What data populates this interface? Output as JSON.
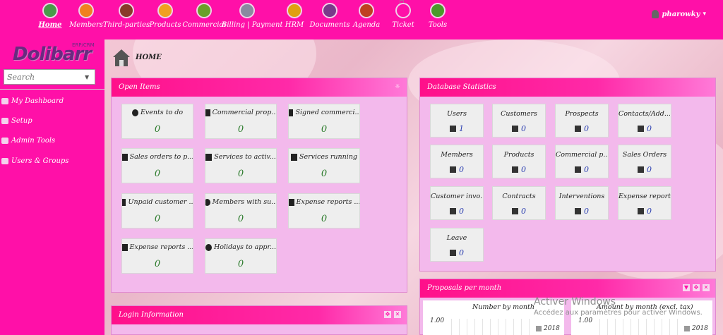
{
  "topnav": {
    "items": [
      {
        "label": "Home",
        "icon": "monitor-icon",
        "color": "#4a9a4a"
      },
      {
        "label": "Members",
        "icon": "members-icon",
        "color": "#f08020"
      },
      {
        "label": "Third-parties",
        "icon": "third-parties-icon",
        "color": "#8a3a2a"
      },
      {
        "label": "Products",
        "icon": "products-icon",
        "color": "#f0a020"
      },
      {
        "label": "Commercial",
        "icon": "commercial-icon",
        "color": "#6aa02a"
      },
      {
        "label": "Billing | Payment",
        "icon": "billing-icon",
        "color": "#8a8aa0"
      },
      {
        "label": "HRM",
        "icon": "hrm-icon",
        "color": "#e0a010"
      },
      {
        "label": "Documents",
        "icon": "documents-icon",
        "color": "#7a3a8a"
      },
      {
        "label": "Agenda",
        "icon": "agenda-icon",
        "color": "#c04020"
      },
      {
        "label": "Ticket",
        "icon": "ticket-icon",
        "color": "#ff10a8"
      },
      {
        "label": "Tools",
        "icon": "tools-icon",
        "color": "#4a9a2a"
      }
    ],
    "user": "pharowky"
  },
  "sidebar": {
    "logo": "Dolibarr",
    "logo_sub": "ERP/CRM",
    "search_placeholder": "Search",
    "items": [
      {
        "label": "My Dashboard",
        "icon": "dashboard-icon"
      },
      {
        "label": "Setup",
        "icon": "wrench-icon"
      },
      {
        "label": "Admin Tools",
        "icon": "admin-tools-icon"
      },
      {
        "label": "Users & Groups",
        "icon": "users-groups-icon"
      }
    ]
  },
  "page": {
    "title": "HOME"
  },
  "open_items": {
    "title": "Open Items",
    "boxes": [
      {
        "label": "Events to do",
        "value": "0",
        "icon": "clock-icon"
      },
      {
        "label": "Commercial prop...",
        "value": "0",
        "icon": "proposal-icon"
      },
      {
        "label": "Signed commerci...",
        "value": "0",
        "icon": "proposal-icon"
      },
      {
        "label": "Sales orders to p...",
        "value": "0",
        "icon": "order-icon"
      },
      {
        "label": "Services to activ...",
        "value": "0",
        "icon": "service-icon"
      },
      {
        "label": "Services running",
        "value": "0",
        "icon": "service-icon"
      },
      {
        "label": "Unpaid customer ...",
        "value": "0",
        "icon": "invoice-icon"
      },
      {
        "label": "Members with su...",
        "value": "0",
        "icon": "member-icon"
      },
      {
        "label": "Expense reports ...",
        "value": "0",
        "icon": "car-icon"
      },
      {
        "label": "Expense reports ...",
        "value": "0",
        "icon": "car-icon"
      },
      {
        "label": "Holidays to appr...",
        "value": "0",
        "icon": "umbrella-icon"
      }
    ]
  },
  "db_stats": {
    "title": "Database Statistics",
    "boxes": [
      {
        "label": "Users",
        "value": "1",
        "icon": "user-icon"
      },
      {
        "label": "Customers",
        "value": "0",
        "icon": "building-icon"
      },
      {
        "label": "Prospects",
        "value": "0",
        "icon": "building-icon"
      },
      {
        "label": "Contacts/Add...",
        "value": "0",
        "icon": "contact-icon"
      },
      {
        "label": "Members",
        "value": "0",
        "icon": "user-icon"
      },
      {
        "label": "Products",
        "value": "0",
        "icon": "product-icon"
      },
      {
        "label": "Commercial p...",
        "value": "0",
        "icon": "proposal-icon"
      },
      {
        "label": "Sales Orders",
        "value": "0",
        "icon": "order-icon"
      },
      {
        "label": "Customer invo...",
        "value": "0",
        "icon": "invoice-icon"
      },
      {
        "label": "Contracts",
        "value": "0",
        "icon": "contract-icon"
      },
      {
        "label": "Interventions",
        "value": "0",
        "icon": "intervention-icon"
      },
      {
        "label": "Expense reports",
        "value": "0",
        "icon": "car-icon"
      },
      {
        "label": "Leave",
        "value": "0",
        "icon": "umbrella-icon"
      }
    ]
  },
  "proposals": {
    "title": "Proposals per month",
    "charts": [
      {
        "title": "Number by month",
        "ytick": "1.00",
        "legend": "2018"
      },
      {
        "title": "Amount by month (excl. tax)",
        "ytick": "1.00",
        "legend": "2018"
      }
    ]
  },
  "login_panel": {
    "title": "Login Information"
  },
  "watermark": {
    "line1": "Activer Windows",
    "line2": "Accédez aux paramètres pour activer Windows."
  }
}
